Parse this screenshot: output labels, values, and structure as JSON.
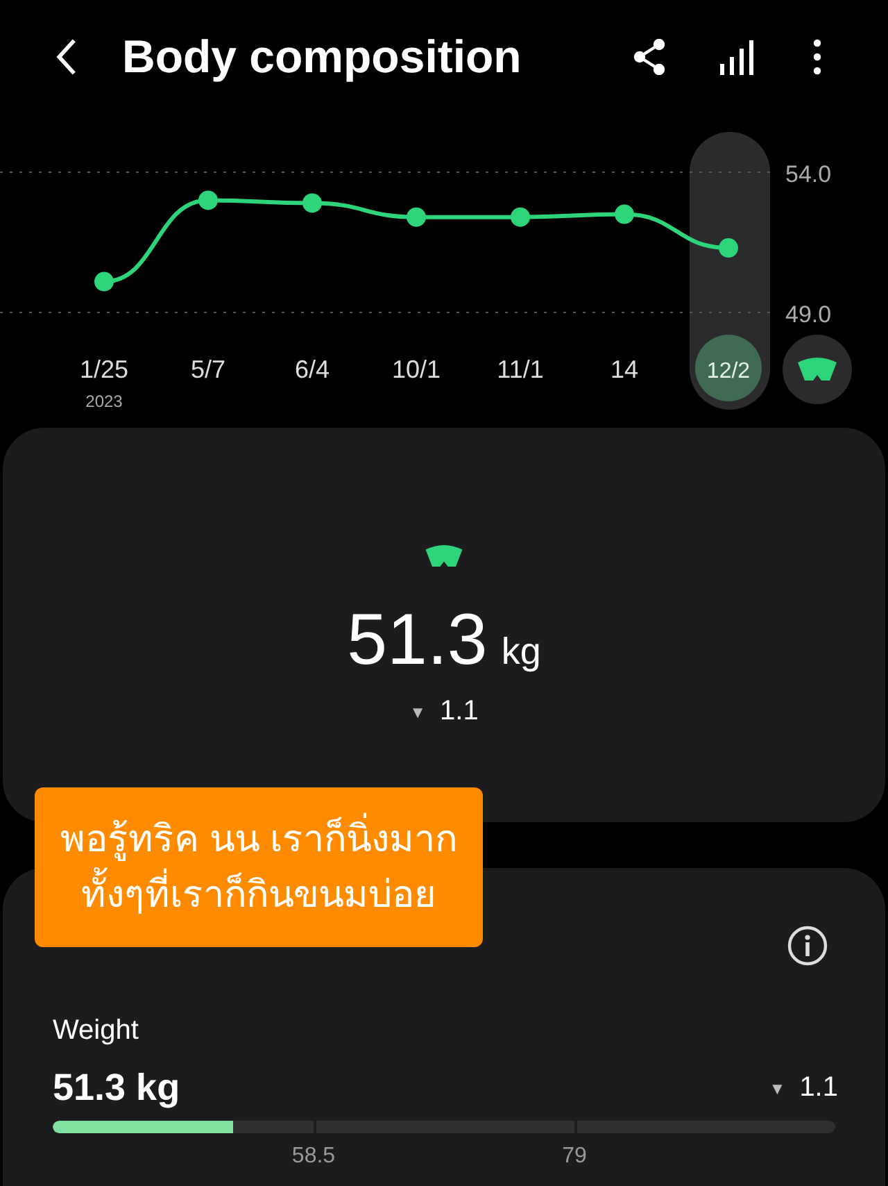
{
  "header": {
    "title": "Body composition"
  },
  "chart": {
    "highlight_last": true,
    "chart_data": {
      "type": "line",
      "categories": [
        "1/25",
        "5/7",
        "6/4",
        "10/1",
        "11/1",
        "14",
        "12/2"
      ],
      "series": [
        {
          "color": "#2ed47a",
          "marker": "circle",
          "values": [
            50.1,
            53.0,
            52.9,
            52.4,
            52.4,
            52.5,
            51.3
          ]
        }
      ],
      "ylim": [
        49,
        54
      ],
      "yticks": [
        {
          "value": 54,
          "label": "54.0"
        },
        {
          "value": 49,
          "label": "49.0"
        }
      ],
      "annotations": [
        {
          "text": "2023"
        }
      ]
    }
  },
  "summary": {
    "value": "51.3",
    "unit": "kg",
    "trend_symbol": "▼",
    "change": "1.1"
  },
  "caption": {
    "lines": [
      "พอรู้ทริค นน เราก็นิ่งมาก",
      "ทั้งๆที่เราก็กินขนมบ่อย"
    ]
  },
  "weight": {
    "label": "Weight",
    "value": "51.3 kg",
    "trend_symbol": "▼",
    "change": "1.1",
    "level": 0.23,
    "ticks": [
      "58.5",
      "79"
    ]
  }
}
